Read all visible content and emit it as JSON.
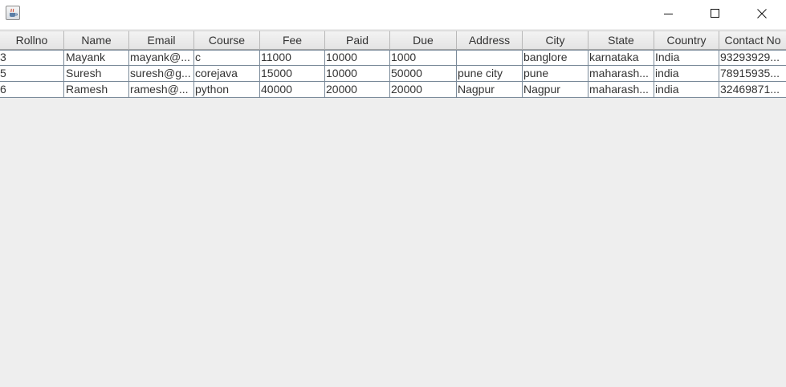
{
  "window": {
    "icon": "java-cup-icon",
    "controls": {
      "minimize": "minimize-icon",
      "maximize": "maximize-icon",
      "close": "close-icon"
    }
  },
  "table": {
    "columns": [
      "Rollno",
      "Name",
      "Email",
      "Course",
      "Fee",
      "Paid",
      "Due",
      "Address",
      "City",
      "State",
      "Country",
      "Contact No"
    ],
    "rows": [
      [
        "3",
        "Mayank",
        "mayank@...",
        "c",
        "11000",
        "10000",
        "1000",
        "",
        "banglore",
        "karnataka",
        "India",
        "93293929..."
      ],
      [
        "5",
        "Suresh",
        "suresh@g...",
        "corejava",
        "15000",
        "10000",
        "50000",
        "pune city",
        "pune",
        "maharash...",
        "india",
        "78915935..."
      ],
      [
        "6",
        "Ramesh",
        "ramesh@...",
        "python",
        "40000",
        "20000",
        "20000",
        "Nagpur",
        "Nagpur",
        "maharash...",
        "india",
        "32469871..."
      ]
    ]
  }
}
